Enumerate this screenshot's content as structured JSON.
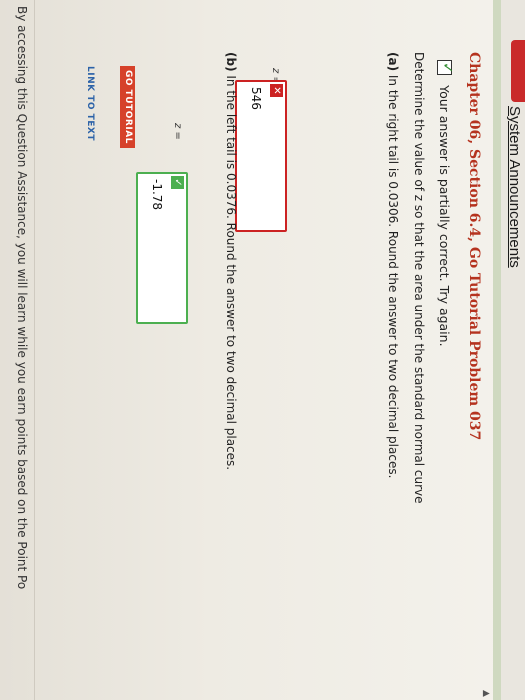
{
  "header": {
    "system_link": "System Announcements"
  },
  "problem": {
    "title": "Chapter 06, Section 6.4, Go Tutorial Problem 037",
    "status": "Your answer is partially correct.  Try again.",
    "instructions": "Determine the value of z so that the area under the standard normal curve",
    "part_a": {
      "label": "(a)",
      "text": " In the right tail is 0.0306. Round the answer to two decimal places.",
      "z_label": "z =",
      "answer": "546",
      "mark": "✕"
    },
    "part_b": {
      "label": "(b)",
      "text": " In the left tail is 0.0376. Round the answer to two decimal places.",
      "z_label": "z =",
      "answer": "-1.78",
      "mark": "✓"
    }
  },
  "actions": {
    "go_tutorial": "GO TUTORIAL",
    "link_to_text": "LINK TO TEXT"
  },
  "footer": {
    "text": "By accessing this Question Assistance, you will learn while you earn points based on the Point Po"
  },
  "colors": {
    "title": "#b5331f",
    "incorrect": "#cc2222",
    "correct": "#4caf50",
    "button": "#d6412a",
    "link": "#2c62a8"
  }
}
